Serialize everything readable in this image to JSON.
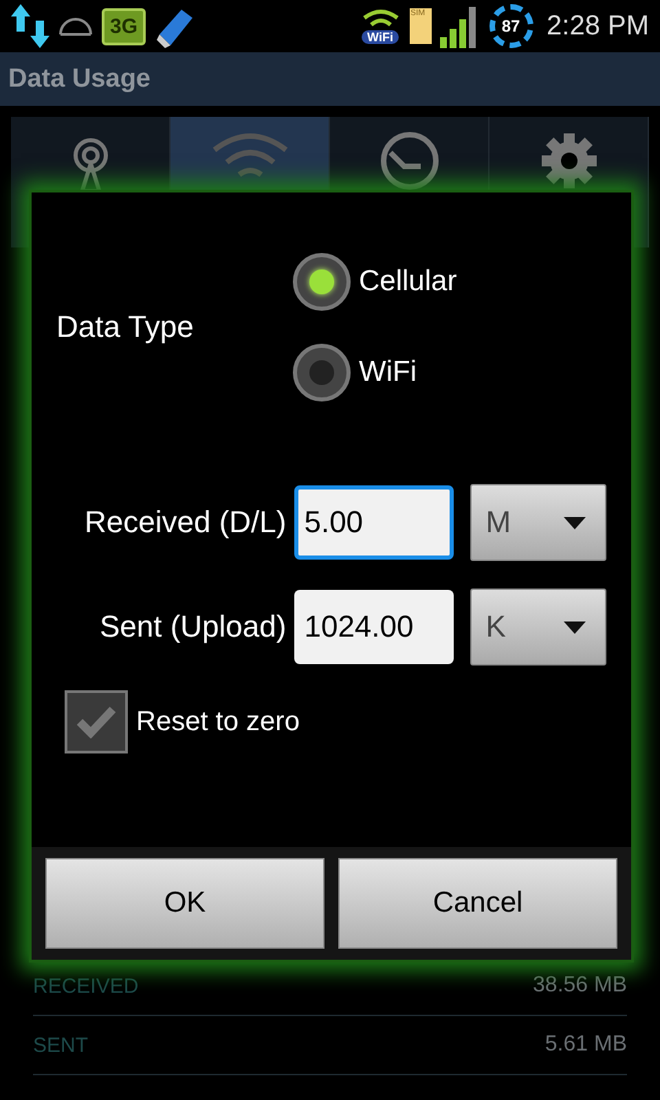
{
  "status_bar": {
    "network": "3G",
    "wifi_label": "WiFi",
    "sim_label": "SIM",
    "battery": "87",
    "time": "2:28 PM"
  },
  "app_bar": {
    "title": "Data Usage"
  },
  "tabs": [
    {
      "kind": "tower",
      "selected": false
    },
    {
      "kind": "wifi",
      "selected": true
    },
    {
      "kind": "clock",
      "selected": false
    },
    {
      "kind": "gear",
      "selected": false
    }
  ],
  "dialog": {
    "data_type_label": "Data Type",
    "options": [
      {
        "label": "Cellular",
        "selected": true
      },
      {
        "label": "WiFi",
        "selected": false
      }
    ],
    "received": {
      "label": "Received (D/L)",
      "value": "5.00",
      "focused": true,
      "unit": "M"
    },
    "sent": {
      "label": "Sent (Upload)",
      "value": "1024.00",
      "focused": false,
      "unit": "K"
    },
    "reset": {
      "label": "Reset to zero",
      "checked": true
    },
    "buttons": [
      "OK",
      "Cancel"
    ]
  },
  "usage": [
    {
      "label": "RECEIVED",
      "value": "38.56 MB"
    },
    {
      "label": "SENT",
      "value": "5.61 MB"
    }
  ]
}
